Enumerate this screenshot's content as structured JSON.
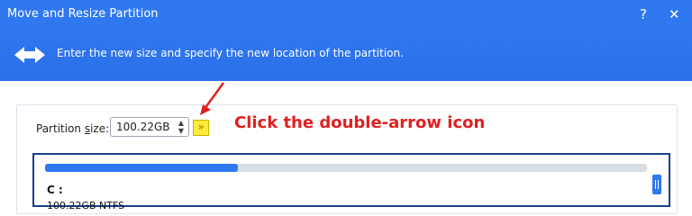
{
  "window": {
    "title": "Move and Resize Partition",
    "help_label": "?",
    "close_label": "✕"
  },
  "banner": {
    "instruction": "Enter the new size and specify the new location of the partition.",
    "icon": "double-headed-arrow-icon"
  },
  "partition_size": {
    "label_prefix": "Partition ",
    "label_accel": "s",
    "label_suffix": "ize:",
    "value": "100.22GB",
    "spin_up": "▲",
    "spin_down": "▼",
    "expand_glyph": "»"
  },
  "annotation": {
    "text": "Click the double-arrow icon",
    "color": "#e02020"
  },
  "partition": {
    "letter": "C :",
    "used_fraction": 0.32,
    "partial_text": "100.22GB NTFS"
  },
  "colors": {
    "accent": "#2f78f0",
    "highlight": "#ffeb3b"
  }
}
